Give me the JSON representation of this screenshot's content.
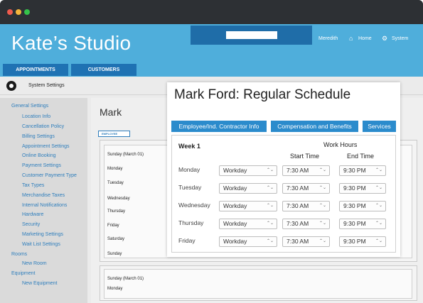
{
  "window": {
    "traffic_lights": [
      "#ef5b4d",
      "#f5b53b",
      "#35c24a"
    ]
  },
  "header": {
    "brand": "Kate’s Studio",
    "user": "Meredith",
    "home": "Home",
    "system": "System",
    "home_icon": "home-icon",
    "system_icon": "system-gear-icon"
  },
  "nav": {
    "tabs": [
      "APPOINTMENTS",
      "CUSTOMERS"
    ]
  },
  "system_bar": {
    "label": "System Settings",
    "icon": "settings-icon"
  },
  "sidebar": {
    "general": "General Settings",
    "general_items": [
      "Location Info",
      "Cancellation Policy",
      "Billing Settings",
      "Appointment Settings",
      "Online Booking",
      "Payment Settings",
      "Customer Payment Type",
      "Tax Types",
      "Merchandise Taxes",
      "Internal Notifications",
      "Hardware",
      "Security",
      "Marketing Settings",
      "Wait List Settings"
    ],
    "rooms": "Rooms",
    "rooms_items": [
      "New Room"
    ],
    "equipment": "Equipment",
    "equipment_items": [
      "New Equipment"
    ]
  },
  "background": {
    "title": "Mark",
    "tag": "EMPLOYEE",
    "week1_header": "Sunday (March 01)",
    "week1_days": [
      "Monday",
      "Tuesday",
      "Wednesday",
      "Thursday",
      "Friday",
      "Saturday",
      "Sunday"
    ],
    "week2_header": "Sunday (March 01)",
    "week2_days": [
      "Monday"
    ]
  },
  "modal": {
    "title": "Mark Ford: Regular Schedule",
    "tabs": [
      "Employee/Ind. Contractor Info",
      "Compensation and Benefits",
      "Services"
    ],
    "week": "Week 1",
    "work_hours": "Work Hours",
    "start_time": "Start Time",
    "end_time": "End Time",
    "rows": [
      {
        "day": "Monday",
        "type": "Workday",
        "start": "7:30 AM",
        "end": "9:30 PM"
      },
      {
        "day": "Tuesday",
        "type": "Workday",
        "start": "7:30 AM",
        "end": "9:30 PM"
      },
      {
        "day": "Wednesday",
        "type": "Workday",
        "start": "7:30 AM",
        "end": "9:30 PM"
      },
      {
        "day": "Thursday",
        "type": "Workday",
        "start": "7:30 AM",
        "end": "9:30 PM"
      },
      {
        "day": "Friday",
        "type": "Workday",
        "start": "7:30 AM",
        "end": "9:30 PM"
      }
    ],
    "accent": "#2b8bcc"
  }
}
